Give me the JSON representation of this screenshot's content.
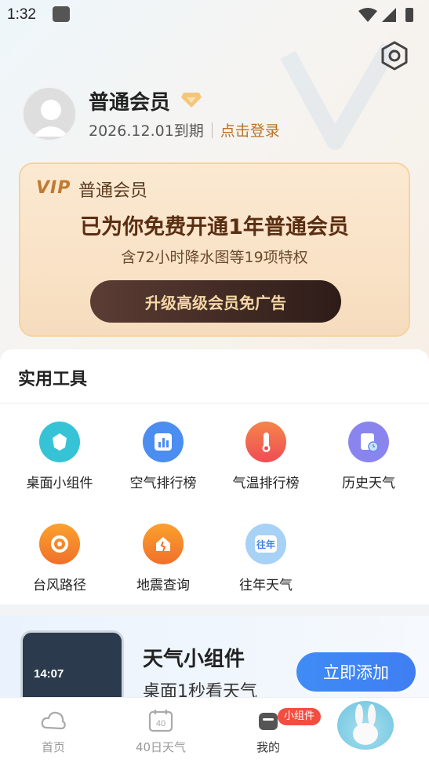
{
  "status_bar": {
    "time": "1:32"
  },
  "profile": {
    "name": "普通会员",
    "expire": "2026.12.01到期",
    "login": "点击登录"
  },
  "vip_card": {
    "logo": "VIP",
    "level": "普通会员",
    "headline": "已为你免费开通1年普通会员",
    "subline": "含72小时降水图等19项特权",
    "button": "升级高级会员免广告"
  },
  "tools": {
    "title": "实用工具",
    "items": [
      {
        "label": "桌面小组件",
        "icon": "widget-icon",
        "color": "#3cc6d8"
      },
      {
        "label": "空气排行榜",
        "icon": "bar-chart-icon",
        "color": "#4b8df0"
      },
      {
        "label": "气温排行榜",
        "icon": "thermometer-icon",
        "color": "#f0634a"
      },
      {
        "label": "历史天气",
        "icon": "calendar-clock-icon",
        "color": "#8b86f0"
      },
      {
        "label": "台风路径",
        "icon": "typhoon-icon",
        "color": "#f58a2a"
      },
      {
        "label": "地震查询",
        "icon": "earthquake-icon",
        "color": "#f58a2a"
      },
      {
        "label": "往年天气",
        "icon": "past-year-icon",
        "color": "#5aa8f2"
      }
    ]
  },
  "widget_promo": {
    "title": "天气小组件",
    "subtitle": "桌面1秒看天气",
    "button": "立即添加",
    "phone_time": "14:07"
  },
  "tab_bar": {
    "tabs": [
      {
        "label": "首页",
        "icon": "home-cloud-icon"
      },
      {
        "label": "40日天气",
        "icon": "calendar-40-icon",
        "badge_text": "40"
      },
      {
        "label": "我的",
        "icon": "profile-icon"
      }
    ],
    "badge": "小组件"
  }
}
